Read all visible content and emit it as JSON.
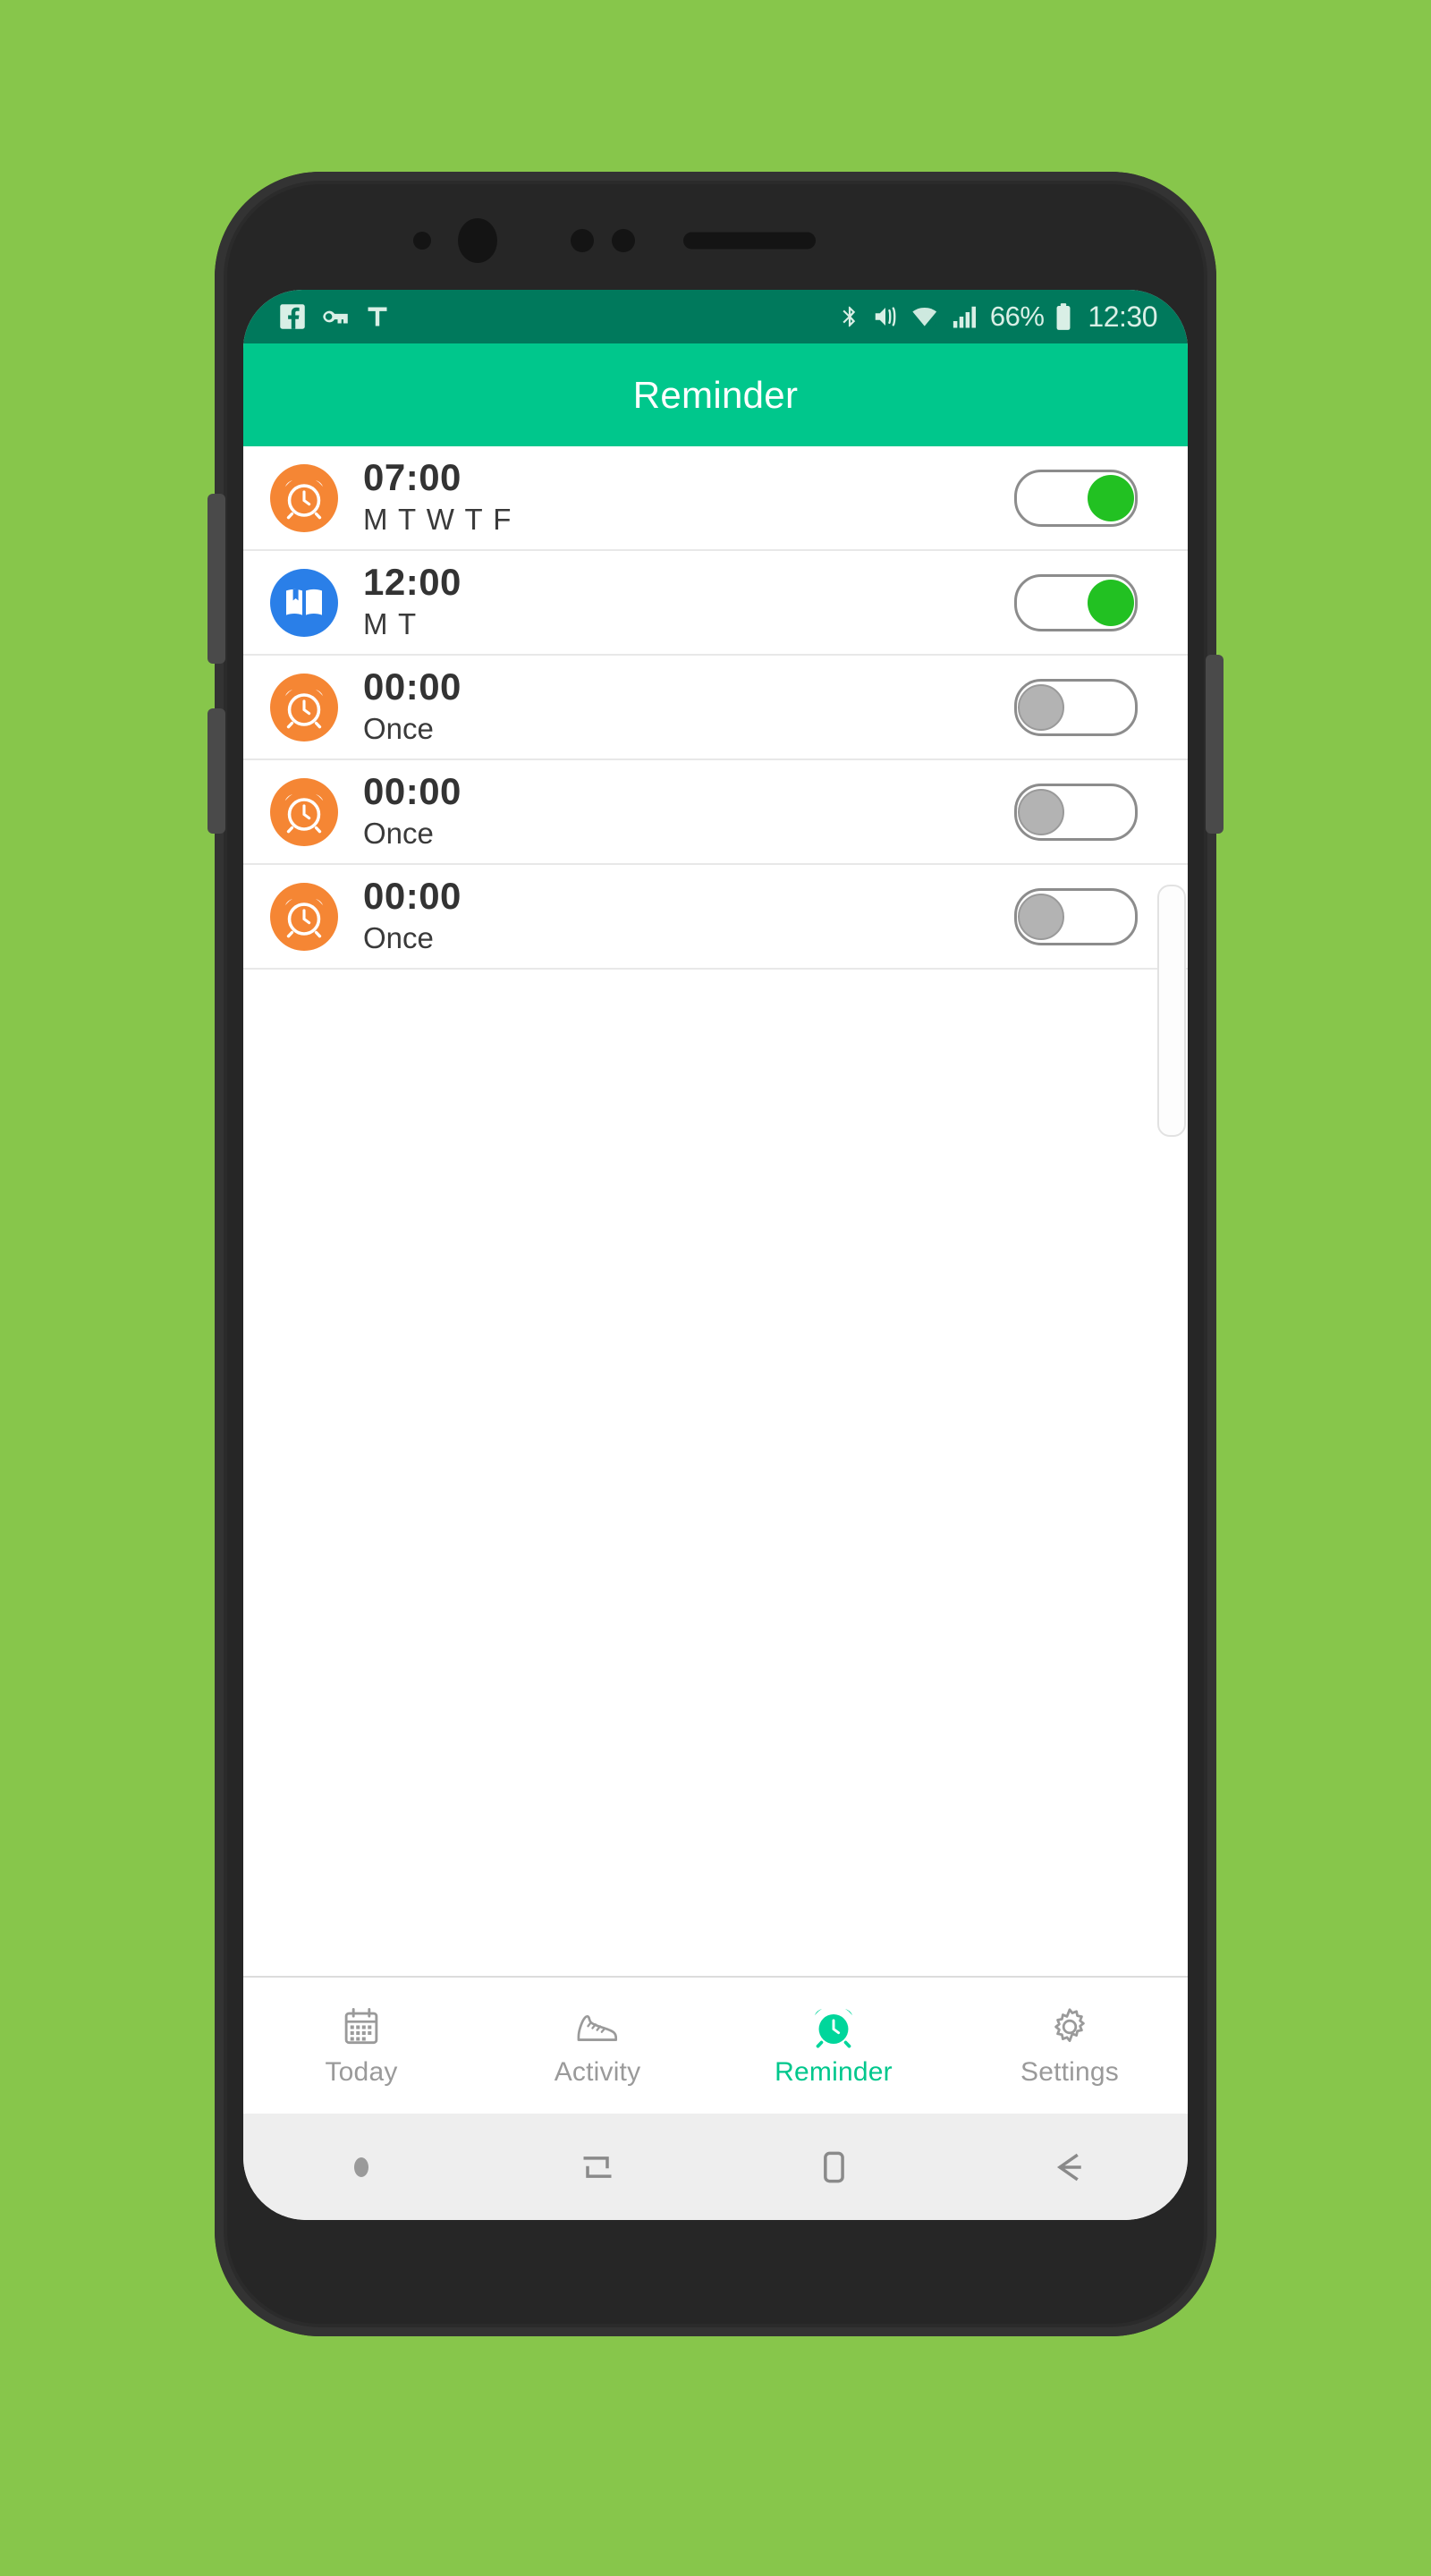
{
  "background": {
    "color": "#87c64b"
  },
  "device": {
    "frame_color": "#2b2b2b",
    "buttons": [
      {
        "name": "bixby-button"
      },
      {
        "name": "volume-down-button"
      },
      {
        "name": "power-button"
      }
    ]
  },
  "statusbar": {
    "background": "#00795c",
    "left_icons": [
      "facebook-icon",
      "vpn-key-icon",
      "text-t-icon"
    ],
    "right_icons": [
      "bluetooth-icon",
      "vibrate-mute-icon",
      "wifi-icon",
      "signal-bars-icon",
      "battery-icon"
    ],
    "battery_percent": "66%",
    "clock": "12:30"
  },
  "appbar": {
    "title": "Reminder",
    "background": "#00c78c"
  },
  "reminders": [
    {
      "icon": "alarm-clock-icon",
      "icon_color": "#f58634",
      "time": "07:00",
      "days": "M T W T F",
      "enabled": true
    },
    {
      "icon": "book-icon",
      "icon_color": "#2a7fe8",
      "time": "12:00",
      "days": "M T",
      "enabled": true
    },
    {
      "icon": "alarm-clock-icon",
      "icon_color": "#f58634",
      "time": "00:00",
      "days": "Once",
      "enabled": false
    },
    {
      "icon": "alarm-clock-icon",
      "icon_color": "#f58634",
      "time": "00:00",
      "days": "Once",
      "enabled": false
    },
    {
      "icon": "alarm-clock-icon",
      "icon_color": "#f58634",
      "time": "00:00",
      "days": "Once",
      "enabled": false
    }
  ],
  "tabs": [
    {
      "label": "Today",
      "icon": "calendar-icon",
      "active": false
    },
    {
      "label": "Activity",
      "icon": "shoe-icon",
      "active": false
    },
    {
      "label": "Reminder",
      "icon": "alarm-clock-icon",
      "active": true
    },
    {
      "label": "Settings",
      "icon": "gear-icon",
      "active": false
    }
  ],
  "navbar": {
    "buttons": [
      "dot-indicator",
      "recents-icon",
      "home-icon",
      "back-icon"
    ]
  },
  "colors": {
    "accent": "#00c78c",
    "status_dark": "#00795c",
    "switch_on": "#22c122",
    "switch_off": "#b3b3b3",
    "alarm_orange": "#f58634",
    "book_blue": "#2a7fe8"
  }
}
